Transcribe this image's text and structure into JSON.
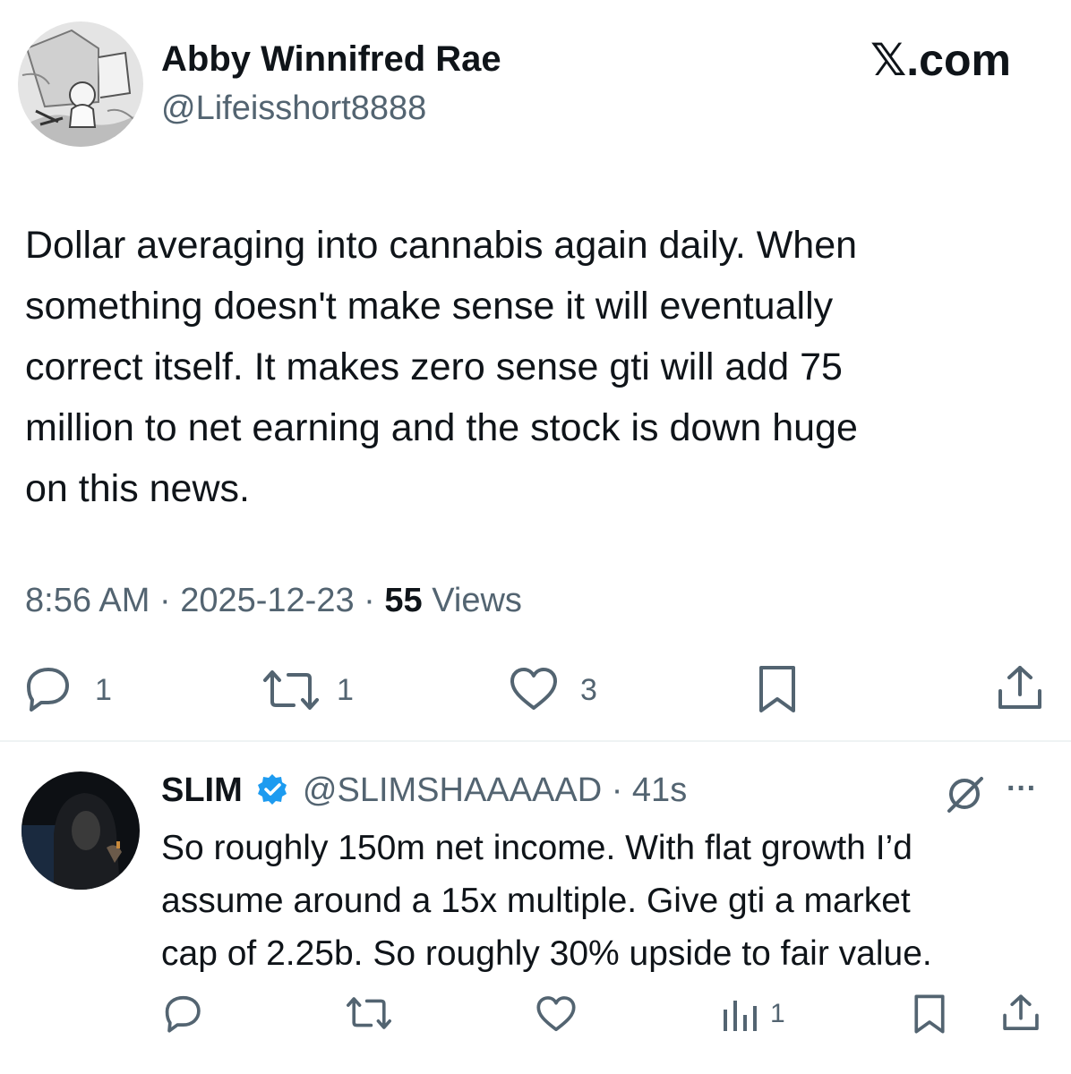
{
  "main_tweet": {
    "author_name": "Abby Winnifred Rae",
    "author_handle": "@Lifeisshort8888",
    "brand": "𝕏.com",
    "text_lines": [
      "Dollar averaging into cannabis again daily. When",
      "something doesn't make sense it will eventually",
      "correct itself. It makes zero sense gti will add 75",
      "million to net earning and the stock is down huge",
      "on this news."
    ],
    "time": "8:56 AM",
    "date": "2025-12-23",
    "separator": "·",
    "views_count": "55",
    "views_label": "Views",
    "reply_count": "1",
    "retweet_count": "1",
    "like_count": "3"
  },
  "reply_tweet": {
    "author_name": "SLIM",
    "author_handle": "@SLIMSHAAAAAD",
    "separator": "·",
    "time_ago": "41s",
    "text_lines": [
      "So roughly 150m net income. With flat growth I’d",
      "assume around a 15x multiple. Give gti a market",
      "cap of 2.25b. So roughly 30% upside to fair value."
    ],
    "views_count": "1",
    "more_label": "···"
  },
  "icons": {
    "reply": "speech-bubble-icon",
    "retweet": "retweet-arrows-icon",
    "like": "heart-icon",
    "bookmark": "bookmark-icon",
    "share": "share-upload-icon",
    "verified": "verified-badge-icon",
    "grok": "grok-slash-circle-icon",
    "views": "bar-chart-icon"
  },
  "colors": {
    "text": "#0f1419",
    "muted": "#536471",
    "verified": "#1d9bf0"
  }
}
